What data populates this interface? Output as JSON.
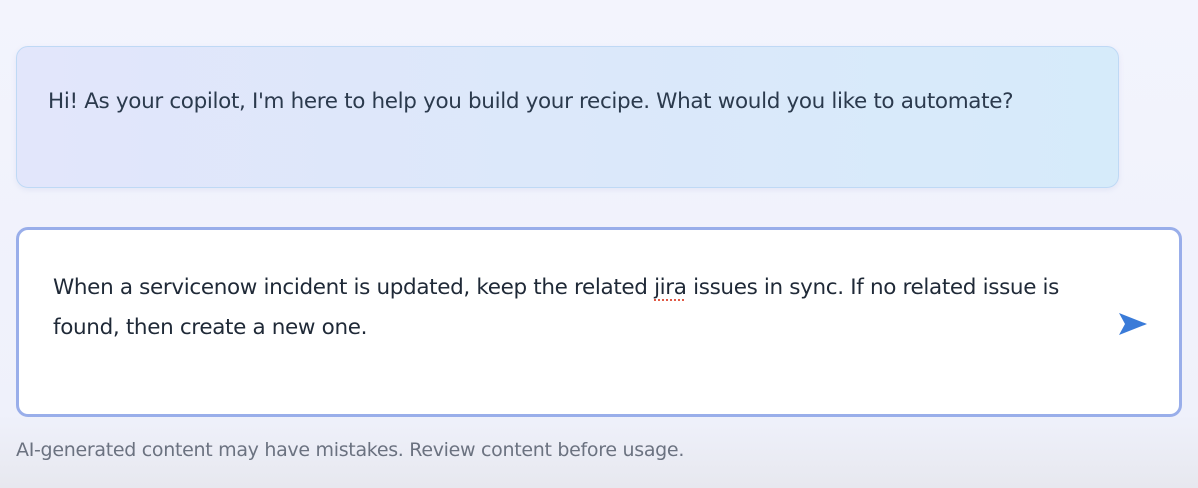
{
  "assistant_message": {
    "text": "Hi! As your copilot, I'm here to help you build your recipe. What would you like to automate?"
  },
  "composer": {
    "text_before": "When a servicenow incident is updated, keep the related ",
    "flagged_word": "jira",
    "text_after": " issues in sync. If no related issue is found, then create a new one.",
    "send_icon": "send-icon"
  },
  "footer": {
    "disclaimer": "AI-generated content may have mistakes. Review content before usage."
  },
  "colors": {
    "composer_border": "#99aeea",
    "send_icon": "#3a7bd8",
    "spellcheck_underline": "#e05a47"
  }
}
